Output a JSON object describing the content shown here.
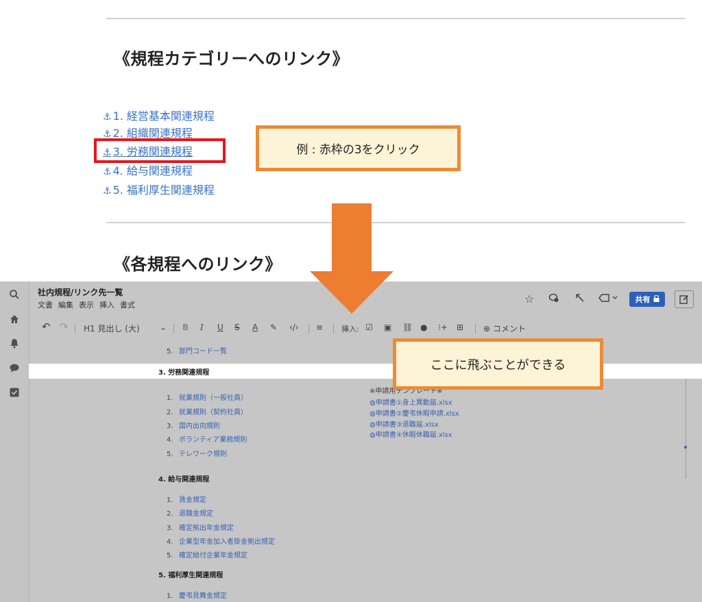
{
  "category_section": {
    "heading": "《規程カテゴリーへのリンク》",
    "links": [
      {
        "icon": "⚓",
        "label": "1. 経営基本関連規程"
      },
      {
        "icon": "⚓",
        "label": "2. 組織関連規程"
      },
      {
        "icon": "⚓",
        "label": "3. 労務関連規程"
      },
      {
        "icon": "⚓",
        "label": "4. 給与関連規程"
      },
      {
        "icon": "⚓",
        "label": "5. 福利厚生関連規程"
      }
    ],
    "callout": "例 : 赤枠の3をクリック"
  },
  "each_section": {
    "heading": "《各規程へのリンク》"
  },
  "jump_callout": "ここに飛ぶことができる",
  "app": {
    "doc_title": "社内規程/リンク先一覧",
    "menu": [
      "文書",
      "編集",
      "表示",
      "挿入",
      "書式"
    ],
    "share_label": "共有",
    "toolbar": {
      "heading_select": "H1 見出し (大)",
      "insert_label": "挿入:",
      "comment_label": "コメント"
    }
  },
  "document": {
    "prev_item": {
      "num": "5.",
      "label": "部門コード一覧"
    },
    "sections": [
      {
        "title": "3. 労務関連規程",
        "items": [
          {
            "num": "1.",
            "label": "就業規則（一般社員）"
          },
          {
            "num": "2.",
            "label": "就業規則（契約社員）"
          },
          {
            "num": "3.",
            "label": "国内出向規則"
          },
          {
            "num": "4.",
            "label": "ボランティア業務規則"
          },
          {
            "num": "5.",
            "label": "テレワーク規則"
          }
        ]
      },
      {
        "title": "4. 給与関連規程",
        "items": [
          {
            "num": "1.",
            "label": "賃金規定"
          },
          {
            "num": "2.",
            "label": "退職金規定"
          },
          {
            "num": "3.",
            "label": "確定拠出年金規定"
          },
          {
            "num": "4.",
            "label": "企業型年金加入者掛金拠出規定"
          },
          {
            "num": "5.",
            "label": "確定給付企業年金規定"
          }
        ]
      },
      {
        "title": "5. 福利厚生関連規程",
        "items": [
          {
            "num": "1.",
            "label": "慶弔見舞金規定"
          }
        ]
      }
    ],
    "templates": {
      "title": "※申請用テンプレート※",
      "files": [
        "申請書①身上異動届.xlsx",
        "申請書②慶弔休暇申請.xlsx",
        "申請書③退職届.xlsx",
        "申請書④休暇休職届.xlsx"
      ]
    }
  },
  "colors": {
    "callout_border": "#ed8b36",
    "callout_fill": "#fdf3d6",
    "highlight_box": "#e8151b",
    "arrow": "#ed7d31",
    "link": "#3872c8",
    "share_button": "#2d5fb8"
  }
}
